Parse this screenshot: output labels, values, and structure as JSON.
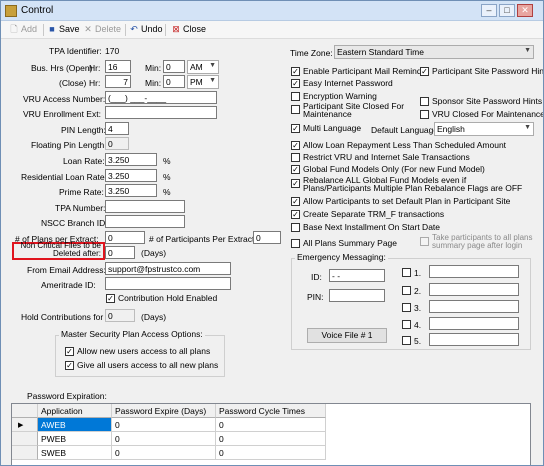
{
  "window": {
    "title": "Control"
  },
  "toolbar": {
    "add": "Add",
    "save": "Save",
    "delete": "Delete",
    "undo": "Undo",
    "close": "Close"
  },
  "form": {
    "tpa_identifier_label": "TPA Identifier:",
    "tpa_identifier": "170",
    "bus_hrs_open_label": "Bus. Hrs (Open)",
    "hr_label": "Hr:",
    "min_label": "Min:",
    "open_hr": "16",
    "open_min": "0",
    "open_ampm": "AM",
    "close_label": "(Close)",
    "close_hr": "7",
    "close_min": "0",
    "close_ampm": "PM",
    "vru_access_label": "VRU Access Number:",
    "vru_access": "(___) ___-____",
    "vru_enroll_label": "VRU Enrollment Ext:",
    "pin_length_label": "PIN Length:",
    "pin_length": "4",
    "floating_pin_label": "Floating Pin Length:",
    "floating_pin": "0",
    "loan_rate_label": "Loan Rate:",
    "loan_rate": "3.250",
    "residential_loan_label": "Residential Loan Rate:",
    "residential_loan": "3.250",
    "prime_rate_label": "Prime Rate:",
    "prime_rate": "3.250",
    "percent": "%",
    "tpa_number_label": "TPA Number:",
    "nscc_branch_label": "NSCC Branch ID:",
    "plans_per_extract_label": "# of Plans per Extract:",
    "plans_per_extract": "0",
    "participants_per_extract_label": "# of Participants Per Extract:",
    "participants_per_extract": "0",
    "non_critical_label": "Non Critical Files to be Deleted after:",
    "non_critical": "0",
    "days": "(Days)",
    "from_email_label": "From Email Address:",
    "from_email": "support@fpstrustco.com",
    "ameritrade_label": "Ameritrade ID:",
    "contribution_hold_label": "Contribution Hold Enabled",
    "hold_contrib_label": "Hold Contributions for",
    "hold_contrib": "0",
    "master_security_label": "Master Security Plan Access Options:",
    "allow_new_users": "Allow new users access to all plans",
    "give_all_users": "Give all users access to all new plans",
    "password_expiration_label": "Password Expiration:"
  },
  "right": {
    "time_zone_label": "Time Zone:",
    "time_zone": "Eastern Standard Time",
    "enable_mail_reminder": "Enable Participant Mail Reminder",
    "participant_site_pw_hints": "Participant Site Password Hints",
    "easy_internet_pw": "Easy Internet Password",
    "encryption_warning": "Encryption Warning",
    "site_closed_maint": "Participant Site Closed For Maintenance",
    "sponsor_pw_hints": "Sponsor Site Password Hints",
    "vru_closed_maint": "VRU Closed For Maintenance",
    "multi_language": "Multi Language",
    "default_language_label": "Default Language:",
    "default_language": "English",
    "allow_loan_repay": "Allow Loan Repayment Less Than Scheduled Amount",
    "restrict_vru": "Restrict VRU and Internet Sale Transactions",
    "global_fund_models": "Global Fund Models Only (For new Fund Model)",
    "rebalance_all": "Rebalance ALL Global Fund Models even if Plans/Participants Multiple Plan Rebalance Flags are OFF",
    "allow_default_plan": "Allow Participants to set Default Plan in Participant Site",
    "create_trm": "Create Separate TRM_F transactions",
    "base_next": "Base Next Installment On Start Date",
    "all_plans_summary": "All Plans Summary Page",
    "take_participants": "Take participants to all plans summary page after login",
    "emergency_label": "Emergency Messaging:",
    "id_label": "ID:",
    "id_value": " - -",
    "pin_label": "PIN:",
    "voice_file": "Voice File # 1",
    "msg_labels": [
      "1.",
      "2.",
      "3.",
      "4.",
      "5."
    ]
  },
  "grid": {
    "columns": [
      "Application",
      "Password Expire (Days)",
      "Password Cycle Times"
    ],
    "rows": [
      {
        "app": "AWEB",
        "expire": "0",
        "cycle": "0"
      },
      {
        "app": "PWEB",
        "expire": "0",
        "cycle": "0"
      },
      {
        "app": "SWEB",
        "expire": "0",
        "cycle": "0"
      }
    ]
  },
  "colors": {
    "highlight_box": "#e0141e",
    "selected_cell": "#0078d7"
  }
}
